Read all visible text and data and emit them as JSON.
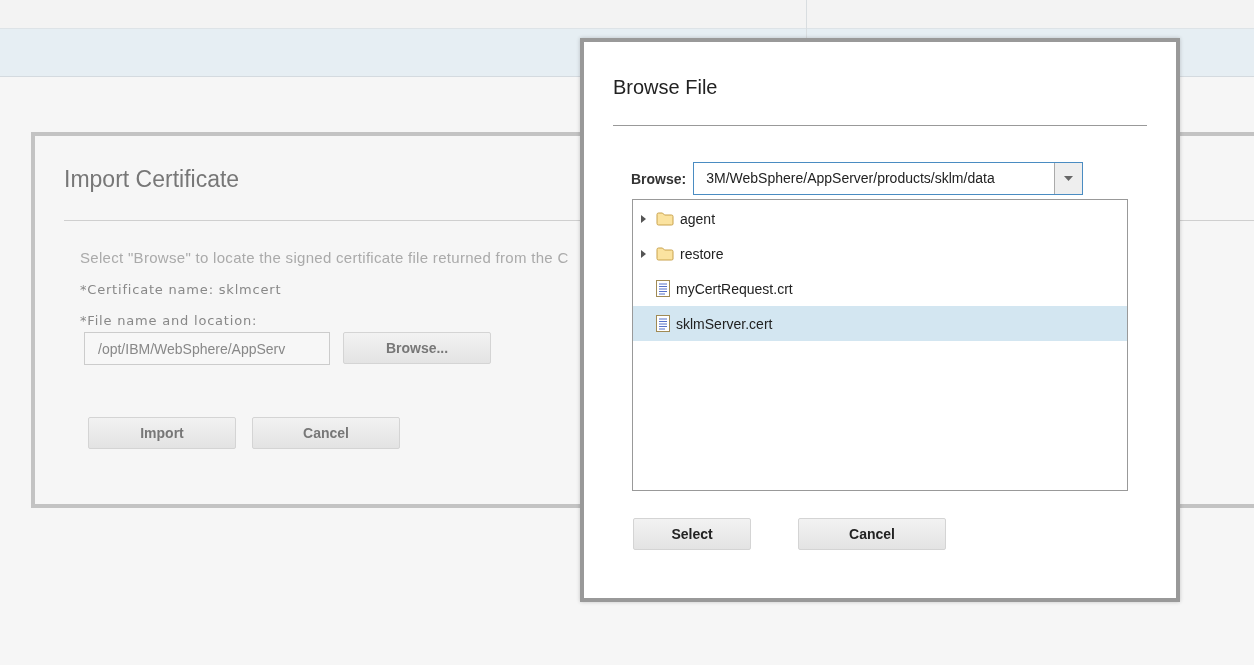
{
  "import_dialog": {
    "title": "Import Certificate",
    "instructions": "Select \"Browse\" to locate the signed certificate file returned from the C",
    "certificate_name": "*Certificate name: sklmcert",
    "file_label": "*File name and location:",
    "file_value": "/opt/IBM/WebSphere/AppServ",
    "browse_button": "Browse...",
    "buttons": [
      "Import",
      "Cancel"
    ]
  },
  "browse_dialog": {
    "title": "Browse File",
    "browse_label": "Browse:",
    "path": "3M/WebSphere/AppServer/products/sklm/data",
    "items": [
      {
        "kind": "folder",
        "name": "agent",
        "expanded": false,
        "selected": false
      },
      {
        "kind": "folder",
        "name": "restore",
        "expanded": false,
        "selected": false
      },
      {
        "kind": "file",
        "name": "myCertRequest.crt",
        "selected": false
      },
      {
        "kind": "file",
        "name": "sklmServer.cert",
        "selected": true
      }
    ],
    "buttons": [
      "Select",
      "Cancel"
    ]
  }
}
